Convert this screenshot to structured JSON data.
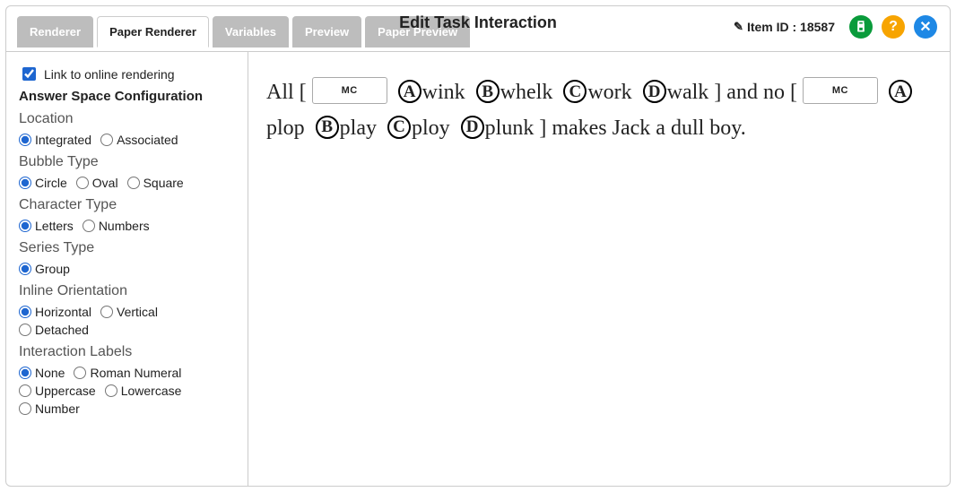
{
  "header": {
    "title": "Edit Task Interaction",
    "item_id_label": "Item ID : 18587"
  },
  "tabs": [
    {
      "id": "renderer",
      "label": "Renderer",
      "active": false
    },
    {
      "id": "paper-renderer",
      "label": "Paper Renderer",
      "active": true
    },
    {
      "id": "variables",
      "label": "Variables",
      "active": false
    },
    {
      "id": "preview",
      "label": "Preview",
      "active": false
    },
    {
      "id": "paper-preview",
      "label": "Paper Preview",
      "active": false
    }
  ],
  "sidebar": {
    "link_checkbox_label": "Link to online rendering",
    "link_checked": true,
    "config_title": "Answer Space Configuration",
    "groups": {
      "location": {
        "heading": "Location",
        "options": [
          "Integrated",
          "Associated"
        ],
        "selected": "Integrated"
      },
      "bubble_type": {
        "heading": "Bubble Type",
        "options": [
          "Circle",
          "Oval",
          "Square"
        ],
        "selected": "Circle"
      },
      "character_type": {
        "heading": "Character Type",
        "options": [
          "Letters",
          "Numbers"
        ],
        "selected": "Letters"
      },
      "series_type": {
        "heading": "Series Type",
        "options": [
          "Group"
        ],
        "selected": "Group"
      },
      "inline_orientation": {
        "heading": "Inline Orientation",
        "options": [
          "Horizontal",
          "Vertical",
          "Detached"
        ],
        "selected": "Horizontal"
      },
      "interaction_labels": {
        "heading": "Interaction Labels",
        "options": [
          "None",
          "Roman Numeral",
          "Uppercase",
          "Lowercase",
          "Number"
        ],
        "selected": "None"
      }
    }
  },
  "preview": {
    "mc_button_label": "MC",
    "text_prefix": "All [",
    "choices1": [
      {
        "letter": "A",
        "word": "wink"
      },
      {
        "letter": "B",
        "word": "whelk"
      },
      {
        "letter": "C",
        "word": "work"
      },
      {
        "letter": "D",
        "word": "walk"
      }
    ],
    "text_mid": "] and no [",
    "choices2": [
      {
        "letter": "A",
        "word": "plop"
      },
      {
        "letter": "B",
        "word": "play"
      },
      {
        "letter": "C",
        "word": "ploy"
      },
      {
        "letter": "D",
        "word": "plunk"
      }
    ],
    "text_suffix": "] makes Jack a dull boy."
  },
  "icons": {
    "save": "save-icon",
    "help": "?",
    "close": "✕"
  }
}
